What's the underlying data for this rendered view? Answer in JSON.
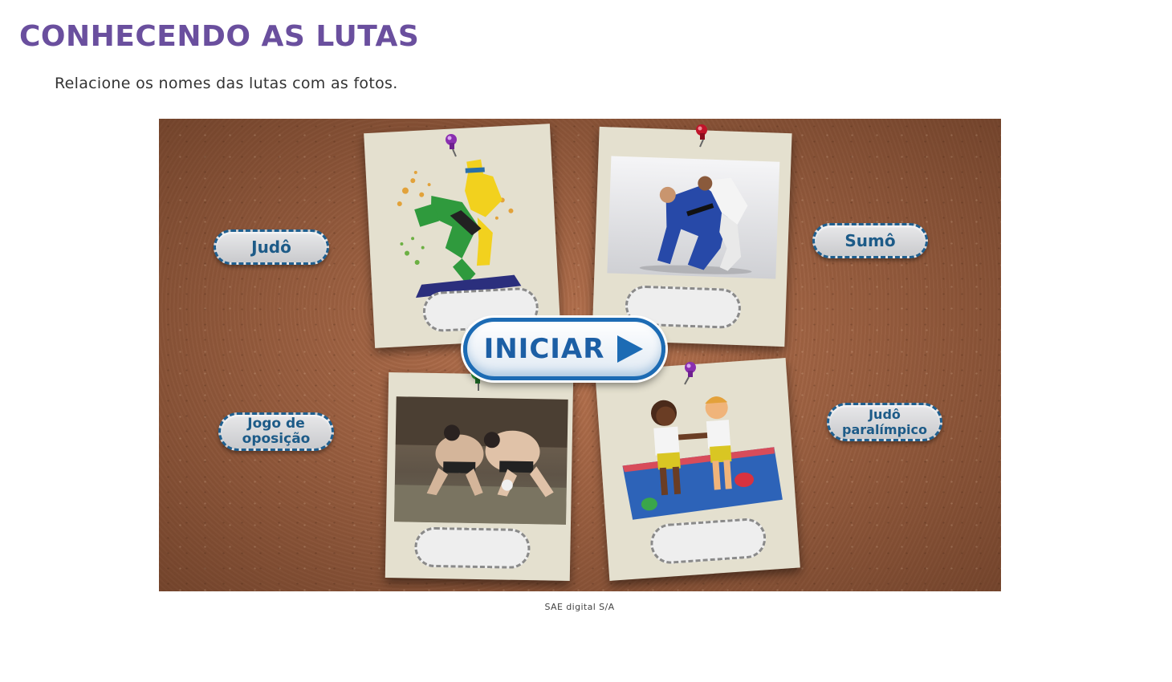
{
  "page": {
    "title": "CONHECENDO AS LUTAS",
    "instruction": "Relacione os nomes das lutas com as fotos.",
    "caption": "SAE digital S/A"
  },
  "activity": {
    "start_label": "INICIAR",
    "labels": {
      "judo": "Judô",
      "sumo": "Sumô",
      "jogo_oposicao_line1": "Jogo de",
      "jogo_oposicao_line2": "oposição",
      "judo_paralimpico_line1": "Judô",
      "judo_paralimpico_line2": "paralímpico"
    },
    "photos": [
      {
        "name": "judo-paralimpico-pictogram",
        "slot": ""
      },
      {
        "name": "judo-photo",
        "slot": ""
      },
      {
        "name": "sumo-photo",
        "slot": ""
      },
      {
        "name": "jogo-de-oposicao-illustration",
        "slot": ""
      }
    ],
    "pin_colors": [
      "#8a2fb0",
      "#c0142a",
      "#2f9b3a",
      "#8a2fb0"
    ],
    "colors": {
      "title": "#6a4f9e",
      "label_text": "#1d5b88",
      "start_button": "#1c6bb4",
      "cork": "#b9744f"
    }
  }
}
